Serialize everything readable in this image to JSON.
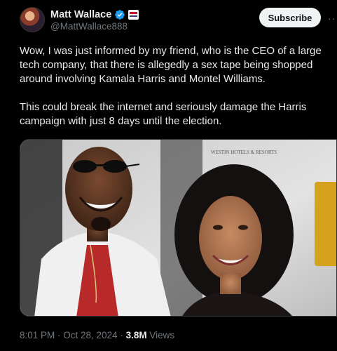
{
  "author": {
    "display_name": "Matt Wallace",
    "handle": "@MattWallace888"
  },
  "actions": {
    "subscribe_label": "Subscribe",
    "more_label": "···"
  },
  "tweet": {
    "paragraph_1": "Wow, I was just informed by my friend, who is the CEO of a large tech company, that there is allegedly a sex tape being shopped around involving Kamala Harris and Montel Williams.",
    "paragraph_2": "This could break the internet and seriously damage the Harris campaign with just 8 days until the election."
  },
  "media": {
    "backdrop_text": "WESTIN HOTELS & RESORTS"
  },
  "meta": {
    "time": "8:01 PM",
    "separator": " · ",
    "date": "Oct 28, 2024",
    "views_count": "3.8M",
    "views_label": "Views"
  },
  "colors": {
    "background": "#000000",
    "text_primary": "#e7e9ea",
    "text_secondary": "#71767b",
    "verified_blue": "#1d9bf0",
    "subscribe_bg": "#eff3f4"
  },
  "icons": {
    "verified": "verified-badge-icon",
    "affiliate": "flag-badge-icon",
    "more": "more-dots-icon"
  }
}
